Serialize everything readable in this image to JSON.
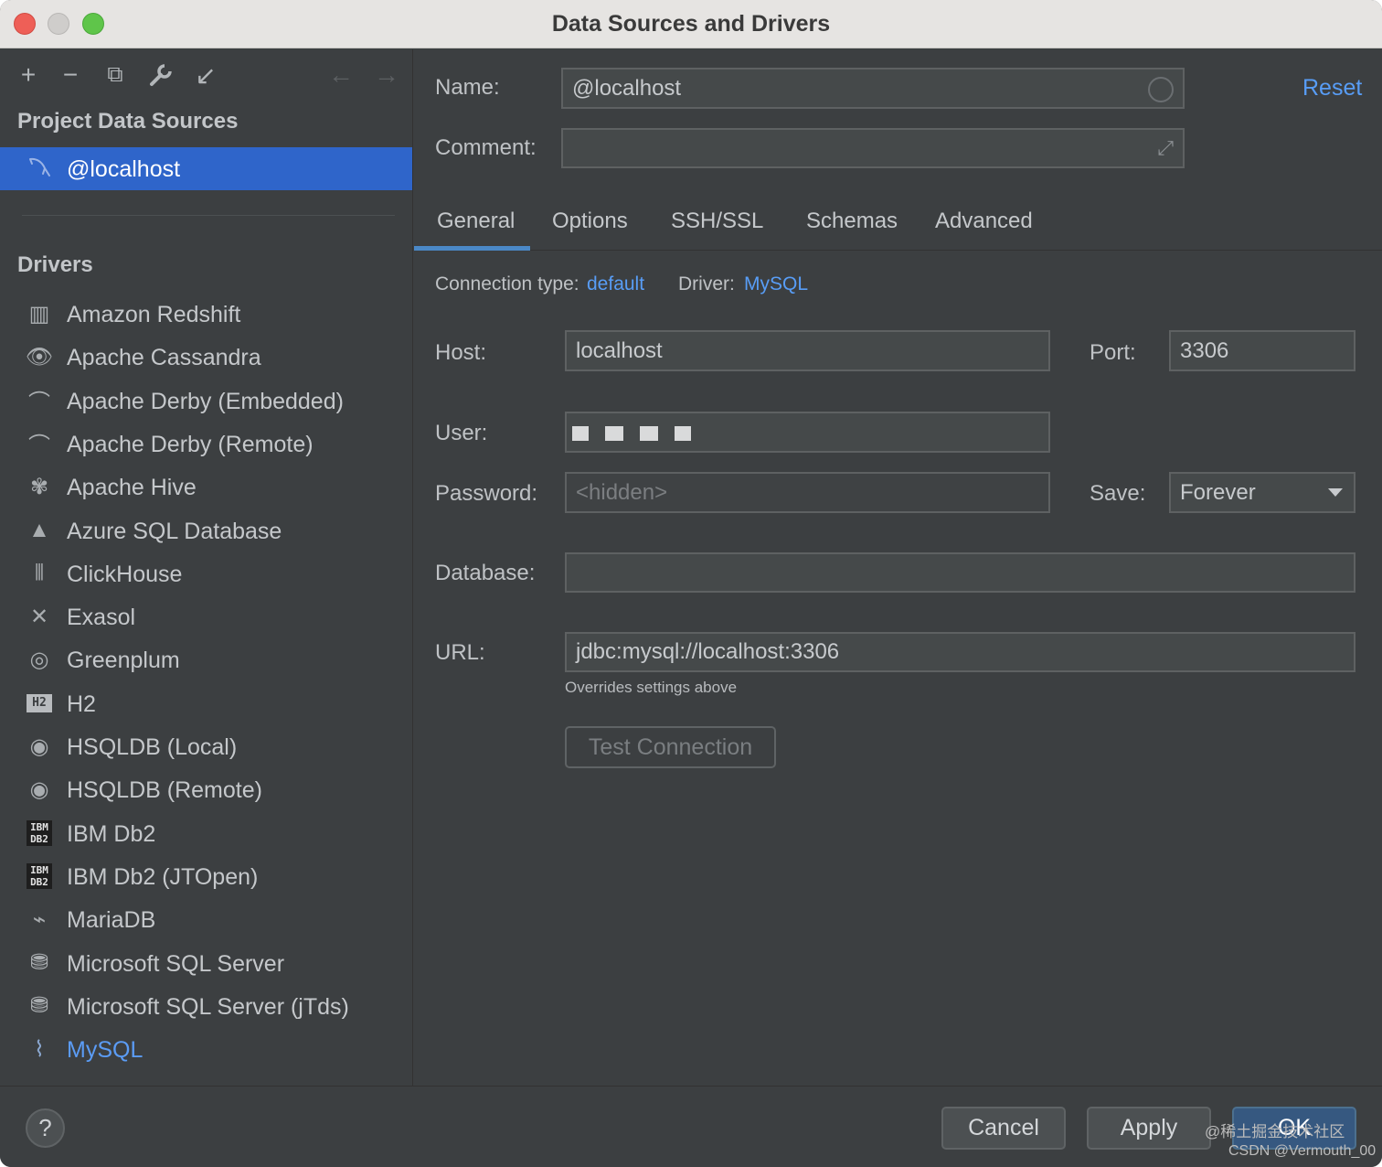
{
  "window": {
    "title": "Data Sources and Drivers"
  },
  "left_panel": {
    "toolbar": {
      "add": "+",
      "remove": "−",
      "duplicate": "⧉",
      "settings": "🔧",
      "import": "↙",
      "back": "←",
      "forward": "→"
    },
    "project_section_title": "Project Data Sources",
    "selected_source": "@localhost",
    "drivers_section_title": "Drivers",
    "drivers": [
      {
        "label": "Amazon Redshift",
        "icon": "redshift-icon"
      },
      {
        "label": "Apache Cassandra",
        "icon": "cassandra-icon"
      },
      {
        "label": "Apache Derby (Embedded)",
        "icon": "derby-icon"
      },
      {
        "label": "Apache Derby (Remote)",
        "icon": "derby-icon"
      },
      {
        "label": "Apache Hive",
        "icon": "hive-icon"
      },
      {
        "label": "Azure SQL Database",
        "icon": "azure-icon"
      },
      {
        "label": "ClickHouse",
        "icon": "clickhouse-icon"
      },
      {
        "label": "Exasol",
        "icon": "exasol-icon"
      },
      {
        "label": "Greenplum",
        "icon": "greenplum-icon"
      },
      {
        "label": "H2",
        "icon": "h2-icon",
        "badge": "H2"
      },
      {
        "label": "HSQLDB (Local)",
        "icon": "hsqldb-icon"
      },
      {
        "label": "HSQLDB (Remote)",
        "icon": "hsqldb-icon"
      },
      {
        "label": "IBM Db2",
        "icon": "ibm-db2-icon",
        "badge": "IBM DB2"
      },
      {
        "label": "IBM Db2 (JTOpen)",
        "icon": "ibm-db2-icon",
        "badge": "IBM DB2"
      },
      {
        "label": "MariaDB",
        "icon": "mariadb-icon"
      },
      {
        "label": "Microsoft SQL Server",
        "icon": "sql-server-icon"
      },
      {
        "label": "Microsoft SQL Server (jTds)",
        "icon": "sql-server-icon"
      },
      {
        "label": "MySQL",
        "icon": "mysql-icon"
      }
    ]
  },
  "form": {
    "name_label": "Name:",
    "name_value": "@localhost",
    "comment_label": "Comment:",
    "comment_value": "",
    "reset_label": "Reset",
    "tabs": [
      "General",
      "Options",
      "SSH/SSL",
      "Schemas",
      "Advanced"
    ],
    "active_tab": "General",
    "connection_type_label": "Connection type:",
    "connection_type_value": "default",
    "driver_label": "Driver:",
    "driver_value": "MySQL",
    "host_label": "Host:",
    "host_value": "localhost",
    "port_label": "Port:",
    "port_value": "3306",
    "user_label": "User:",
    "password_label": "Password:",
    "password_placeholder": "<hidden>",
    "save_label": "Save:",
    "save_value": "Forever",
    "database_label": "Database:",
    "database_value": "",
    "url_label": "URL:",
    "url_value": "jdbc:mysql://localhost:3306",
    "url_hint": "Overrides settings above",
    "test_connection_label": "Test Connection"
  },
  "footer": {
    "help": "?",
    "cancel": "Cancel",
    "apply": "Apply",
    "ok": "OK",
    "watermark_1": "@稀土掘金技术社区",
    "watermark_2": "CSDN @Vermouth_00"
  },
  "colors": {
    "accent": "#2f65ca",
    "link": "#589df6",
    "panel": "#3c3f41"
  }
}
